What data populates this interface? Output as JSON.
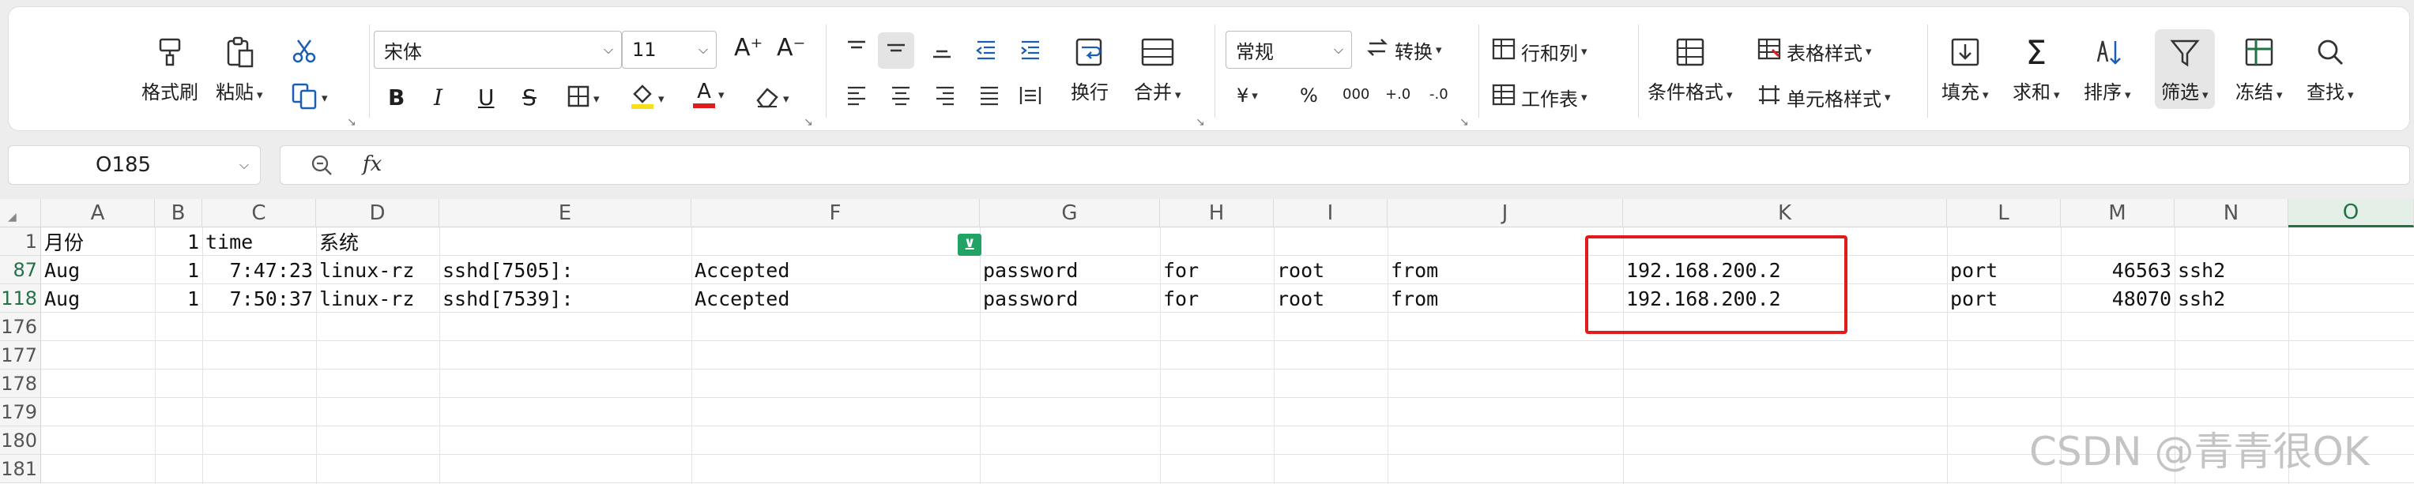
{
  "ribbon": {
    "format_painter": "格式刷",
    "paste": "粘贴",
    "font_name": "宋体",
    "font_size": "11",
    "number_format": "常规",
    "convert": "转换",
    "wrap": "换行",
    "merge": "合并",
    "rows_cols": "行和列",
    "worksheet": "工作表",
    "cond_format": "条件格式",
    "table_style": "表格样式",
    "cell_style": "单元格样式",
    "fill": "填充",
    "sum": "求和",
    "sort": "排序",
    "filter": "筛选",
    "freeze": "冻结",
    "find": "查找",
    "bold": "B",
    "italic": "I",
    "underline": "U",
    "strike": "S",
    "font_color_a": "A",
    "grow_font": "A⁺",
    "shrink_font": "A⁻",
    "percent": "%",
    "thousands": "000",
    "inc_decimal": "+.0",
    "dec_decimal": "-.0",
    "currency": "¥"
  },
  "formula_bar": {
    "name_box": "O185",
    "fx": "fx"
  },
  "colors": {
    "accent_green": "#217346",
    "highlight_red": "#e01b1b"
  },
  "columns": [
    "A",
    "B",
    "C",
    "D",
    "E",
    "F",
    "G",
    "H",
    "I",
    "J",
    "K",
    "L",
    "M",
    "N",
    "O"
  ],
  "rows": [
    {
      "num": "1",
      "green": false,
      "cells": {
        "A": "月份",
        "B": "1",
        "C": "time",
        "D": "系统"
      }
    },
    {
      "num": "87",
      "green": true,
      "cells": {
        "A": "Aug",
        "B": "1",
        "C": "7:47:23",
        "D": "linux-rz",
        "E": "sshd[7505]:",
        "F": "Accepted",
        "G": "password",
        "H": "for",
        "I": "root",
        "J": "from",
        "K": "192.168.200.2",
        "L": "port",
        "M": "46563",
        "N": "ssh2"
      }
    },
    {
      "num": "118",
      "green": true,
      "cells": {
        "A": "Aug",
        "B": "1",
        "C": "7:50:37",
        "D": "linux-rz",
        "E": "sshd[7539]:",
        "F": "Accepted",
        "G": "password",
        "H": "for",
        "I": "root",
        "J": "from",
        "K": "192.168.200.2",
        "L": "port",
        "M": "48070",
        "N": "ssh2"
      }
    },
    {
      "num": "176",
      "green": false,
      "cells": {}
    },
    {
      "num": "177",
      "green": false,
      "cells": {}
    },
    {
      "num": "178",
      "green": false,
      "cells": {}
    },
    {
      "num": "179",
      "green": false,
      "cells": {}
    },
    {
      "num": "180",
      "green": false,
      "cells": {}
    },
    {
      "num": "181",
      "green": false,
      "cells": {}
    }
  ],
  "watermark": "CSDN @青青很OK"
}
